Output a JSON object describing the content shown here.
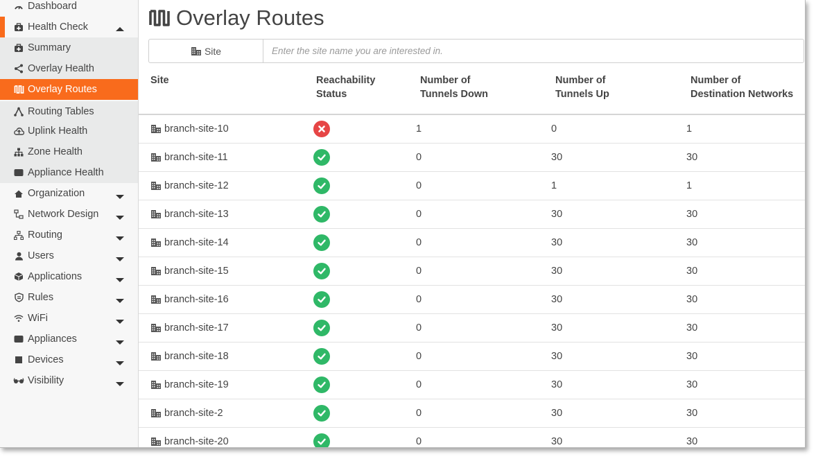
{
  "sidebar": {
    "dashboard": "Dashboard",
    "health_check": "Health Check",
    "summary": "Summary",
    "overlay_health": "Overlay Health",
    "overlay_routes": "Overlay Routes",
    "routing_tables": "Routing Tables",
    "uplink_health": "Uplink Health",
    "zone_health": "Zone Health",
    "appliance_health": "Appliance Health",
    "organization": "Organization",
    "network_design": "Network Design",
    "routing": "Routing",
    "users": "Users",
    "applications": "Applications",
    "rules": "Rules",
    "wifi": "WiFi",
    "appliances": "Appliances",
    "devices": "Devices",
    "visibility": "Visibility"
  },
  "page": {
    "title": "Overlay Routes"
  },
  "search": {
    "addon_label": "Site",
    "placeholder": "Enter the site name you are interested in."
  },
  "table": {
    "headers": {
      "site": "Site",
      "reach_1": "Reachability",
      "reach_2": "Status",
      "down_1": "Number of",
      "down_2": "Tunnels Down",
      "up_1": "Number of",
      "up_2": "Tunnels Up",
      "dest_1": "Number of",
      "dest_2": "Destination Networks"
    },
    "rows": [
      {
        "site": "branch-site-10",
        "status": "error",
        "down": "1",
        "up": "0",
        "dest": "1"
      },
      {
        "site": "branch-site-11",
        "status": "ok",
        "down": "0",
        "up": "30",
        "dest": "30"
      },
      {
        "site": "branch-site-12",
        "status": "ok",
        "down": "0",
        "up": "1",
        "dest": "1"
      },
      {
        "site": "branch-site-13",
        "status": "ok",
        "down": "0",
        "up": "30",
        "dest": "30"
      },
      {
        "site": "branch-site-14",
        "status": "ok",
        "down": "0",
        "up": "30",
        "dest": "30"
      },
      {
        "site": "branch-site-15",
        "status": "ok",
        "down": "0",
        "up": "30",
        "dest": "30"
      },
      {
        "site": "branch-site-16",
        "status": "ok",
        "down": "0",
        "up": "30",
        "dest": "30"
      },
      {
        "site": "branch-site-17",
        "status": "ok",
        "down": "0",
        "up": "30",
        "dest": "30"
      },
      {
        "site": "branch-site-18",
        "status": "ok",
        "down": "0",
        "up": "30",
        "dest": "30"
      },
      {
        "site": "branch-site-19",
        "status": "ok",
        "down": "0",
        "up": "30",
        "dest": "30"
      },
      {
        "site": "branch-site-2",
        "status": "ok",
        "down": "0",
        "up": "30",
        "dest": "30"
      },
      {
        "site": "branch-site-20",
        "status": "ok",
        "down": "0",
        "up": "30",
        "dest": "30"
      }
    ]
  },
  "colors": {
    "accent": "#f96b1c",
    "ok": "#2fb867",
    "error": "#e64545"
  }
}
